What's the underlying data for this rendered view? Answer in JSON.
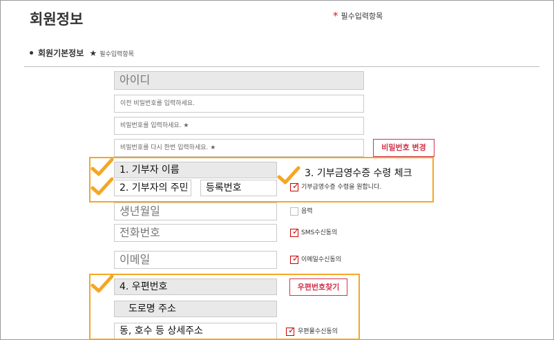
{
  "page": {
    "title": "회원정보",
    "required_note": "필수입력항목",
    "required_star": "*"
  },
  "section": {
    "title": "회원기본정보",
    "star": "★",
    "sub": "필수입력항목"
  },
  "fields": {
    "user_id": "아이디",
    "current_password": "이전 비밀번호를 입력하세요.",
    "new_password": "비밀번호를 입력하세요. ★",
    "confirm_password": "비밀번호를 다시 한번 입력하세요. ★",
    "donor_name": "1. 기부자 이름",
    "rrn_part1": "2. 기부자의 주민",
    "rrn_part2": "등록번호",
    "birthdate": "생년월일",
    "phone": "전화번호",
    "email": "이메일",
    "postcode": "4. 우편번호",
    "road_address": "도로명 주소",
    "detail_address": "동, 호수 등 상세주소"
  },
  "buttons": {
    "change_password": "비밀번호 변경",
    "find_postcode": "우편번호찾기"
  },
  "checkboxes": {
    "receipt": {
      "label": "기부금영수증 수령을 원합니다.",
      "checked": true
    },
    "lunar": {
      "label": "음력",
      "checked": false
    },
    "sms": {
      "label": "SMS수신동의",
      "checked": true
    },
    "email_consent": {
      "label": "이메일수신동의",
      "checked": true
    },
    "mail": {
      "label": "우편물수신동의",
      "checked": true
    }
  },
  "annotations": {
    "receipt_check": "3. 기부금영수증 수령 체크"
  },
  "colors": {
    "accent_red": "#d2334a",
    "highlight_orange": "#f5a623"
  },
  "icons": {
    "checkmark": "orange-checkmark-icon",
    "check_tick": "✓"
  }
}
